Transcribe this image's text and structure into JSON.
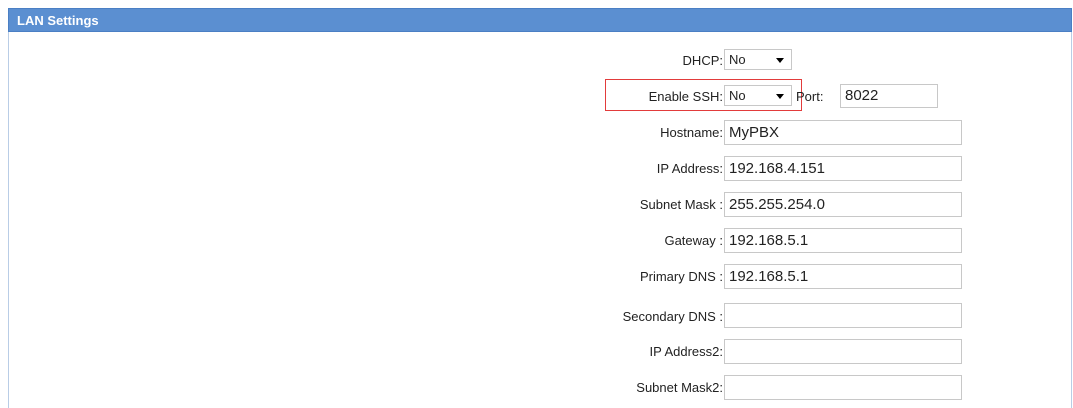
{
  "panel": {
    "title": "LAN Settings"
  },
  "dhcp": {
    "label": "DHCP:",
    "value": "No"
  },
  "ssh": {
    "label": "Enable SSH:",
    "value": "No",
    "port_label": "Port:",
    "port_value": "8022"
  },
  "fields": [
    {
      "label": "Hostname:",
      "value": "MyPBX"
    },
    {
      "label": "IP Address:",
      "value": "192.168.4.151"
    },
    {
      "label": "Subnet Mask :",
      "value": "255.255.254.0"
    },
    {
      "label": "Gateway :",
      "value": "192.168.5.1"
    },
    {
      "label": "Primary DNS :",
      "value": "192.168.5.1"
    },
    {
      "label": "Secondary DNS :",
      "value": ""
    },
    {
      "label": "IP Address2:",
      "value": ""
    },
    {
      "label": "Subnet Mask2:",
      "value": ""
    }
  ],
  "colors": {
    "header_bg": "#5b8fd1",
    "highlight_border": "#e23b3b"
  }
}
